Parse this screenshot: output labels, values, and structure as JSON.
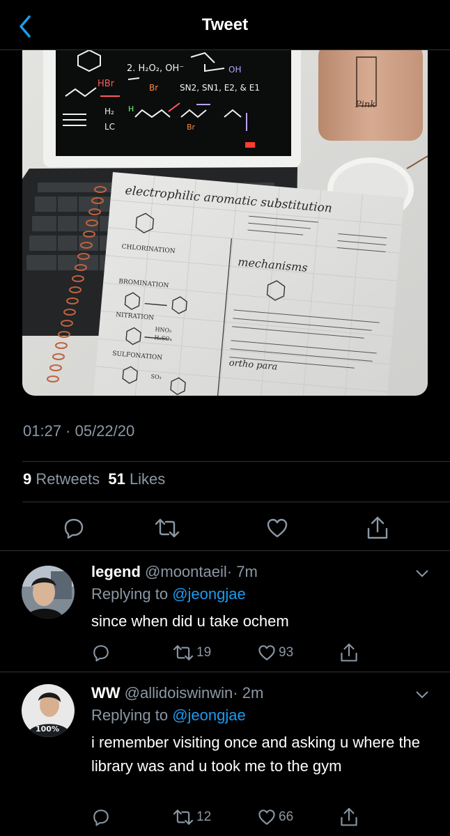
{
  "header": {
    "title": "Tweet"
  },
  "tweet": {
    "timestamp": "01:27 · 05/22/20",
    "retweet_count": "9",
    "retweet_label": "Retweets",
    "like_count": "51",
    "like_label": "Likes",
    "media": {
      "slide_row1": "2. H₂O₂, OH⁻",
      "slide_oh": "OH",
      "slide_hbr": "HBr",
      "slide_br": "Br",
      "slide_reactions": "SN2, SN1, E2, & E1",
      "slide_h2": "H₂",
      "slide_lc": "LC",
      "slide_h": "H",
      "slide_br2": "Br",
      "cup_label": "Pink",
      "notebook_title": "electrophilic aromatic substitution",
      "chlorination": "CHLORINATION",
      "bromination": "BROMINATION",
      "nitration": "NITRATION",
      "sulfonation": "SULFONATION",
      "mechanisms": "mechanisms",
      "ortho_para": "ortho para",
      "hno3": "HNO₃",
      "h2so4": "H₂SO₄",
      "so3": "SO₃"
    }
  },
  "replies": [
    {
      "name": "legend",
      "handle": "@moontaeil",
      "time": "· 7m",
      "replying_label": "Replying to",
      "replying_handle": "@jeongjae",
      "text": "since when did u take ochem",
      "retweets": "19",
      "likes": "93"
    },
    {
      "name": "WW",
      "handle": "@allidoiswinwin",
      "time": "· 2m",
      "replying_label": "Replying to",
      "replying_handle": "@jeongjae",
      "text": "i remember visiting once and asking u where the library was and u took me to the gym",
      "retweets": "12",
      "likes": "66",
      "avatar_text": "100%"
    }
  ],
  "colors": {
    "accent": "#1d9bf0",
    "muted": "#8b98a5",
    "divider": "#2f3336"
  }
}
